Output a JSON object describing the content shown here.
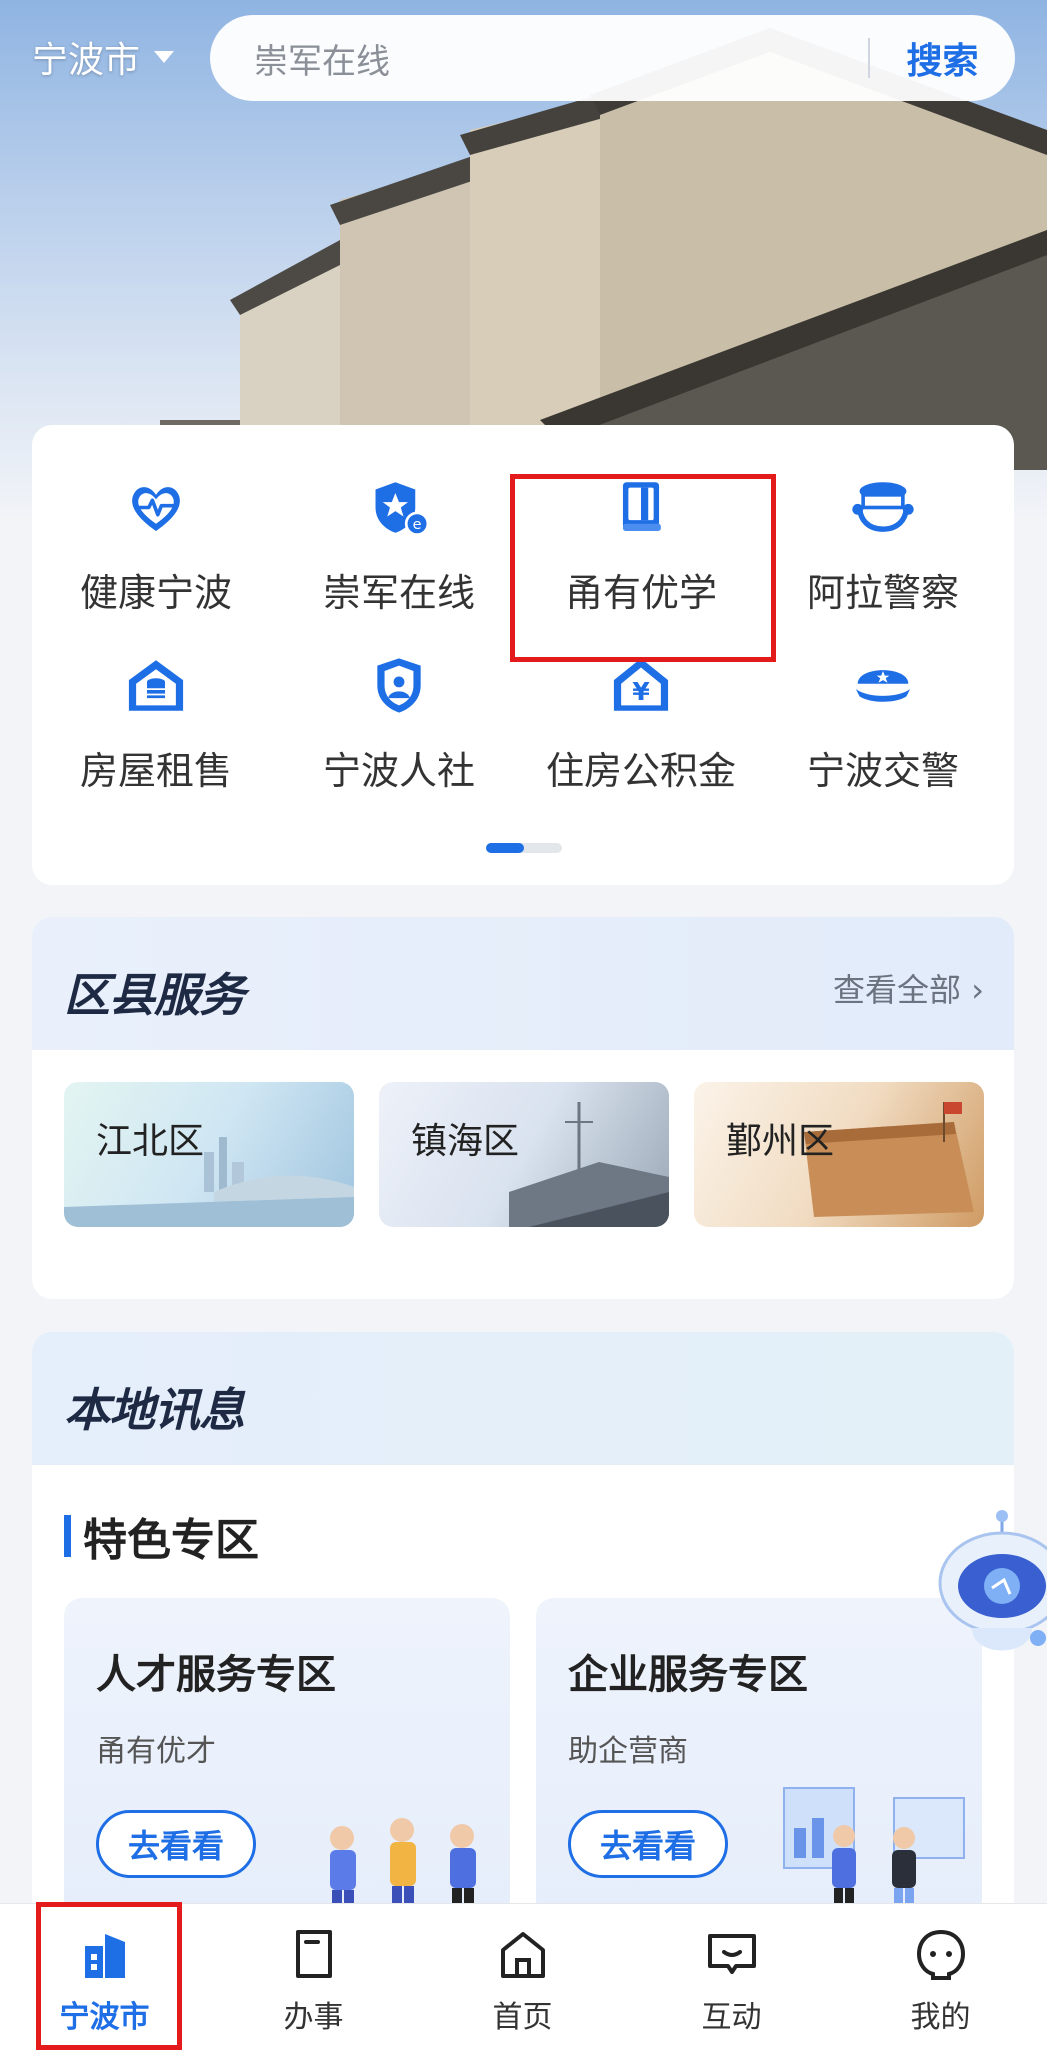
{
  "header": {
    "city": "宁波市",
    "search_placeholder": "崇军在线",
    "search_button": "搜索"
  },
  "quick_services": [
    {
      "label": "健康宁波",
      "icon": "heart-pulse-icon"
    },
    {
      "label": "崇军在线",
      "icon": "star-shield-icon"
    },
    {
      "label": "甬有优学",
      "icon": "book-icon"
    },
    {
      "label": "阿拉警察",
      "icon": "police-hat-icon"
    },
    {
      "label": "房屋租售",
      "icon": "house-database-icon"
    },
    {
      "label": "宁波人社",
      "icon": "person-shield-icon"
    },
    {
      "label": "住房公积金",
      "icon": "house-yen-icon"
    },
    {
      "label": "宁波交警",
      "icon": "traffic-police-cap-icon"
    }
  ],
  "district": {
    "title": "区县服务",
    "view_all": "查看全部",
    "items": [
      {
        "label": "江北区"
      },
      {
        "label": "镇海区"
      },
      {
        "label": "鄞州区"
      }
    ]
  },
  "news": {
    "title": "本地讯息",
    "section": "特色专区",
    "promos": [
      {
        "title": "人才服务专区",
        "subtitle": "甬有优才",
        "button": "去看看"
      },
      {
        "title": "企业服务专区",
        "subtitle": "助企营商",
        "button": "去看看"
      }
    ]
  },
  "tabbar": [
    {
      "label": "宁波市",
      "icon": "city-building-icon",
      "active": true
    },
    {
      "label": "办事",
      "icon": "document-icon",
      "active": false
    },
    {
      "label": "首页",
      "icon": "home-icon",
      "active": false
    },
    {
      "label": "互动",
      "icon": "chat-icon",
      "active": false
    },
    {
      "label": "我的",
      "icon": "profile-face-icon",
      "active": false
    }
  ],
  "colors": {
    "accent": "#1e6ee6",
    "highlight": "#e31b1b"
  }
}
